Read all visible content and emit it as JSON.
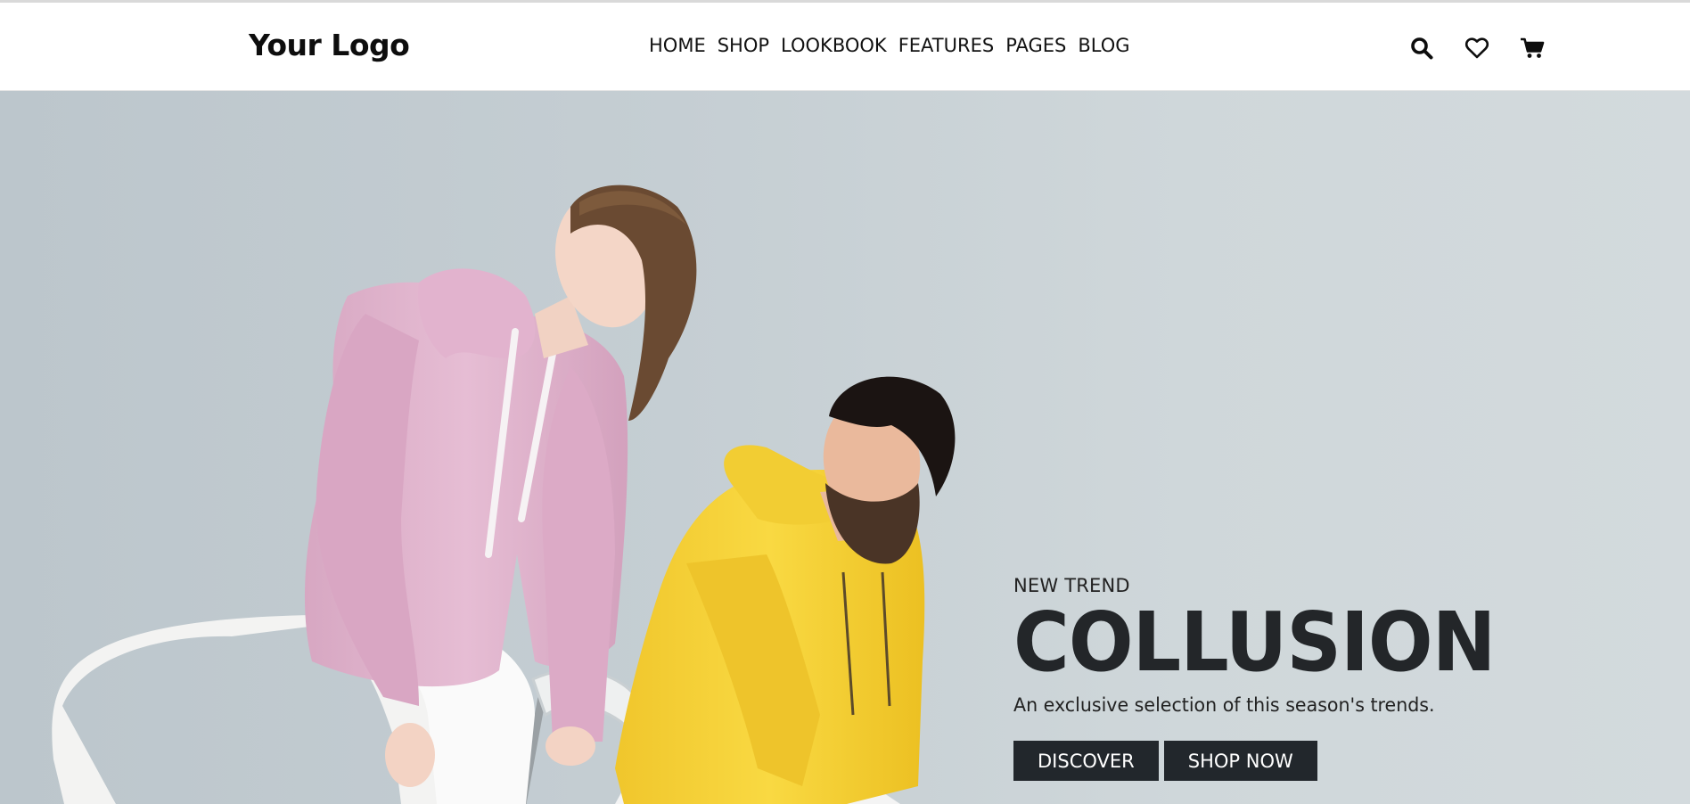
{
  "header": {
    "logo": "Your Logo",
    "nav": [
      "HOME",
      "SHOP",
      "LOOKBOOK",
      "FEATURES",
      "PAGES",
      "BLOG"
    ],
    "icons": [
      "search-icon",
      "heart-icon",
      "cart-icon"
    ]
  },
  "hero": {
    "eyebrow": "NEW TREND",
    "headline": "COLLUSION",
    "subhead": "An exclusive selection of this season's trends.",
    "buttons": {
      "discover": "DISCOVER",
      "shop_now": "SHOP NOW"
    },
    "colors": {
      "background": "#c8d1d5",
      "button": "#22272c",
      "pink_hoodie": "#e3b6cf",
      "yellow_hoodie": "#f7d63a"
    }
  }
}
